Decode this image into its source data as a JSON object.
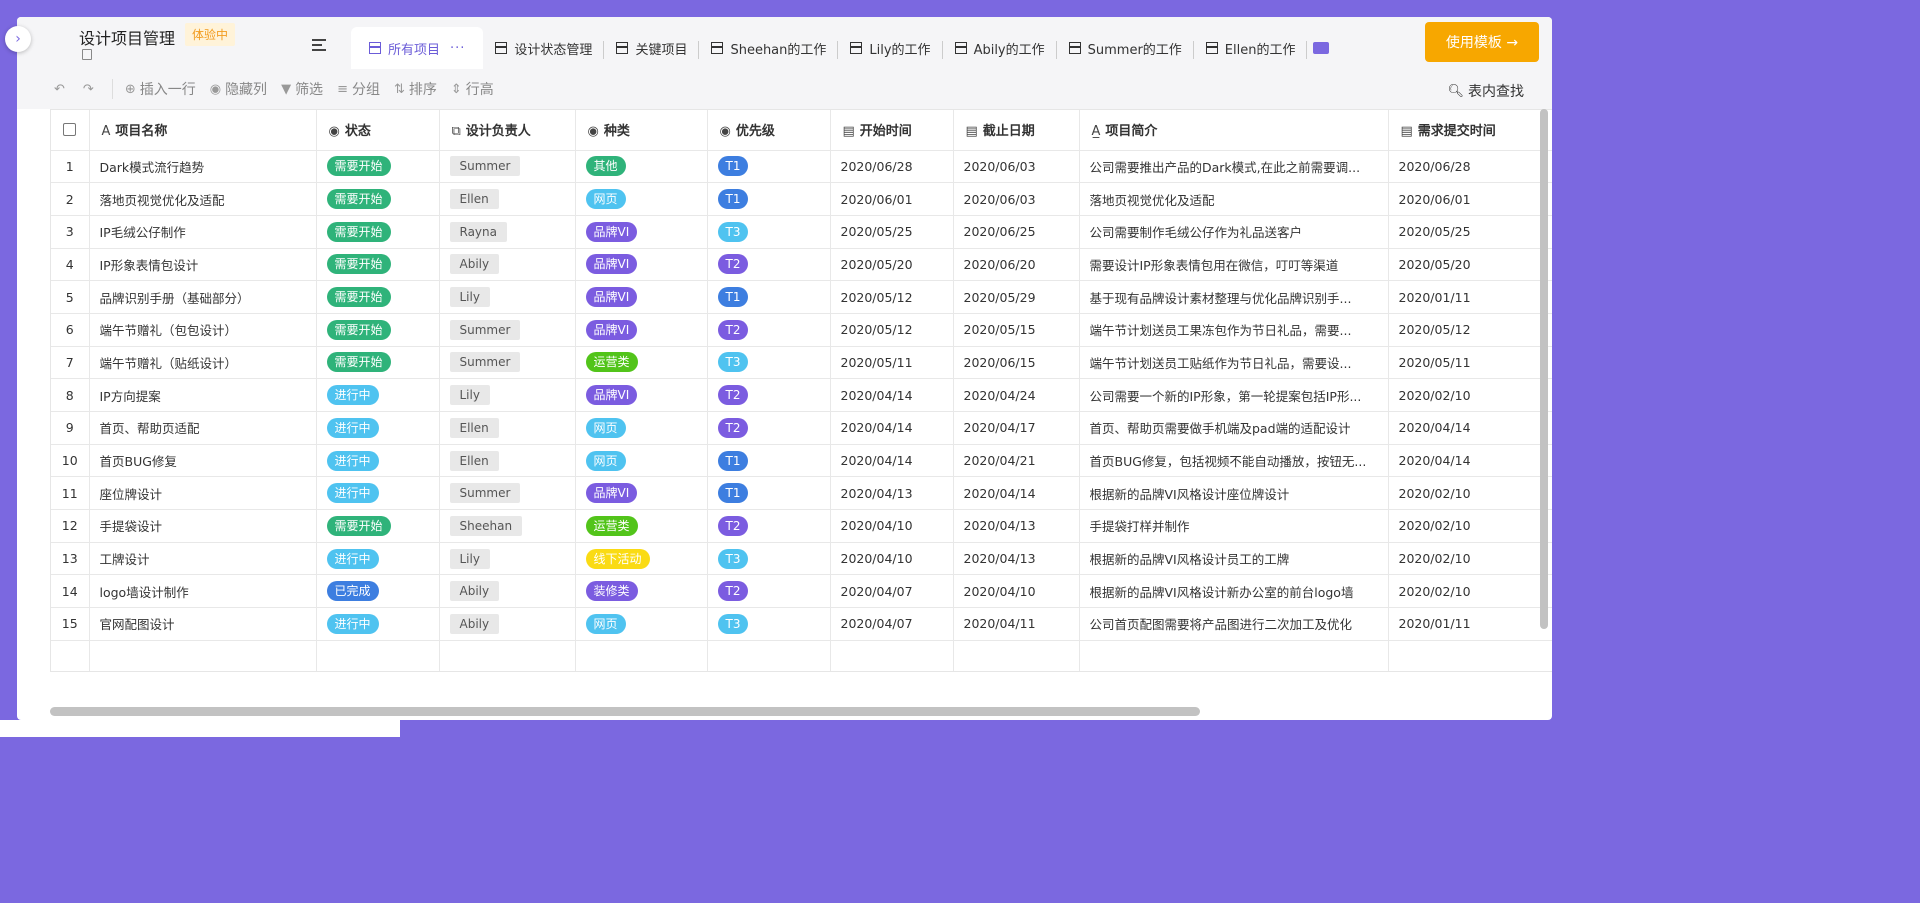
{
  "header": {
    "title": "设计项目管理",
    "badge": "体验中",
    "use_template_label": "使用模板 →"
  },
  "tabs": [
    {
      "label": "所有项目",
      "active": true,
      "more": "···"
    },
    {
      "label": "设计状态管理"
    },
    {
      "label": "关键项目"
    },
    {
      "label": "Sheehan的工作"
    },
    {
      "label": "Lily的工作"
    },
    {
      "label": "Abily的工作"
    },
    {
      "label": "Summer的工作"
    },
    {
      "label": "Ellen的工作"
    }
  ],
  "toolbar": {
    "insert_row": "插入一行",
    "hide_cols": "隐藏列",
    "filter": "筛选",
    "group": "分组",
    "sort": "排序",
    "row_height": "行高",
    "search_in_table": "表内查找"
  },
  "columns": [
    "项目名称",
    "状态",
    "设计负责人",
    "种类",
    "优先级",
    "开始时间",
    "截止日期",
    "项目简介",
    "需求提交时间"
  ],
  "colors": {
    "accent": "#7b68e0",
    "status_need_start": "#2fb37a",
    "status_in_progress": "#4fc3f0",
    "status_done": "#3d7ee0",
    "cat_other": "#2fb37a",
    "cat_web": "#4fc3f0",
    "cat_brand": "#7b5ce0",
    "cat_ops": "#52c41a",
    "cat_offline": "#fadb14",
    "cat_decor": "#7b5ce0",
    "pri_t1": "#3d7ee0",
    "pri_t2": "#7b5ce0",
    "pri_t3": "#4fc3f0"
  },
  "rows": [
    {
      "no": "1",
      "name": "Dark模式流行趋势",
      "status": "需要开始",
      "owner": "Summer",
      "category": "其他",
      "priority": "T1",
      "start": "2020/06/28",
      "due": "2020/06/03",
      "desc": "公司需要推出产品的Dark模式,在此之前需要调...",
      "submit": "2020/06/28"
    },
    {
      "no": "2",
      "name": "落地页视觉优化及适配",
      "status": "需要开始",
      "owner": "Ellen",
      "category": "网页",
      "priority": "T1",
      "start": "2020/06/01",
      "due": "2020/06/03",
      "desc": "落地页视觉优化及适配",
      "submit": "2020/06/01"
    },
    {
      "no": "3",
      "name": "IP毛绒公仔制作",
      "status": "需要开始",
      "owner": "Rayna",
      "category": "品牌VI",
      "priority": "T3",
      "start": "2020/05/25",
      "due": "2020/06/25",
      "desc": "公司需要制作毛绒公仔作为礼品送客户",
      "submit": "2020/05/25"
    },
    {
      "no": "4",
      "name": "IP形象表情包设计",
      "status": "需要开始",
      "owner": "Abily",
      "category": "品牌VI",
      "priority": "T2",
      "start": "2020/05/20",
      "due": "2020/06/20",
      "desc": "需要设计IP形象表情包用在微信，叮叮等渠道",
      "submit": "2020/05/20"
    },
    {
      "no": "5",
      "name": "品牌识别手册（基础部分）",
      "status": "需要开始",
      "owner": "Lily",
      "category": "品牌VI",
      "priority": "T1",
      "start": "2020/05/12",
      "due": "2020/05/29",
      "desc": "基于现有品牌设计素材整理与优化品牌识别手...",
      "submit": "2020/01/11"
    },
    {
      "no": "6",
      "name": "端午节赠礼（包包设计）",
      "status": "需要开始",
      "owner": "Summer",
      "category": "品牌VI",
      "priority": "T2",
      "start": "2020/05/12",
      "due": "2020/05/15",
      "desc": "端午节计划送员工果冻包作为节日礼品，需要...",
      "submit": "2020/05/12"
    },
    {
      "no": "7",
      "name": "端午节赠礼（贴纸设计）",
      "status": "需要开始",
      "owner": "Summer",
      "category": "运营类",
      "priority": "T3",
      "start": "2020/05/11",
      "due": "2020/06/15",
      "desc": "端午节计划送员工贴纸作为节日礼品，需要设...",
      "submit": "2020/05/11"
    },
    {
      "no": "8",
      "name": "IP方向提案",
      "status": "进行中",
      "owner": "Lily",
      "category": "品牌VI",
      "priority": "T2",
      "start": "2020/04/14",
      "due": "2020/04/24",
      "desc": "公司需要一个新的IP形象，第一轮提案包括IP形...",
      "submit": "2020/02/10"
    },
    {
      "no": "9",
      "name": "首页、帮助页适配",
      "status": "进行中",
      "owner": "Ellen",
      "category": "网页",
      "priority": "T2",
      "start": "2020/04/14",
      "due": "2020/04/17",
      "desc": "首页、帮助页需要做手机端及pad端的适配设计",
      "submit": "2020/04/14"
    },
    {
      "no": "10",
      "name": "首页BUG修复",
      "status": "进行中",
      "owner": "Ellen",
      "category": "网页",
      "priority": "T1",
      "start": "2020/04/14",
      "due": "2020/04/21",
      "desc": "首页BUG修复，包括视频不能自动播放，按钮无...",
      "submit": "2020/04/14"
    },
    {
      "no": "11",
      "name": "座位牌设计",
      "status": "进行中",
      "owner": "Summer",
      "category": "品牌VI",
      "priority": "T1",
      "start": "2020/04/13",
      "due": "2020/04/14",
      "desc": "根据新的品牌VI风格设计座位牌设计",
      "submit": "2020/02/10"
    },
    {
      "no": "12",
      "name": "手提袋设计",
      "status": "需要开始",
      "owner": "Sheehan",
      "category": "运营类",
      "priority": "T2",
      "start": "2020/04/10",
      "due": "2020/04/13",
      "desc": "手提袋打样并制作",
      "submit": "2020/02/10"
    },
    {
      "no": "13",
      "name": "工牌设计",
      "status": "进行中",
      "owner": "Lily",
      "category": "线下活动",
      "priority": "T3",
      "start": "2020/04/10",
      "due": "2020/04/13",
      "desc": "根据新的品牌VI风格设计员工的工牌",
      "submit": "2020/02/10"
    },
    {
      "no": "14",
      "name": "logo墙设计制作",
      "status": "已完成",
      "owner": "Abily",
      "category": "装修类",
      "priority": "T2",
      "start": "2020/04/07",
      "due": "2020/04/10",
      "desc": "根据新的品牌VI风格设计新办公室的前台logo墙",
      "submit": "2020/02/10"
    },
    {
      "no": "15",
      "name": "官网配图设计",
      "status": "进行中",
      "owner": "Abily",
      "category": "网页",
      "priority": "T3",
      "start": "2020/04/07",
      "due": "2020/04/11",
      "desc": "公司首页配图需要将产品图进行二次加工及优化",
      "submit": "2020/01/11"
    }
  ]
}
